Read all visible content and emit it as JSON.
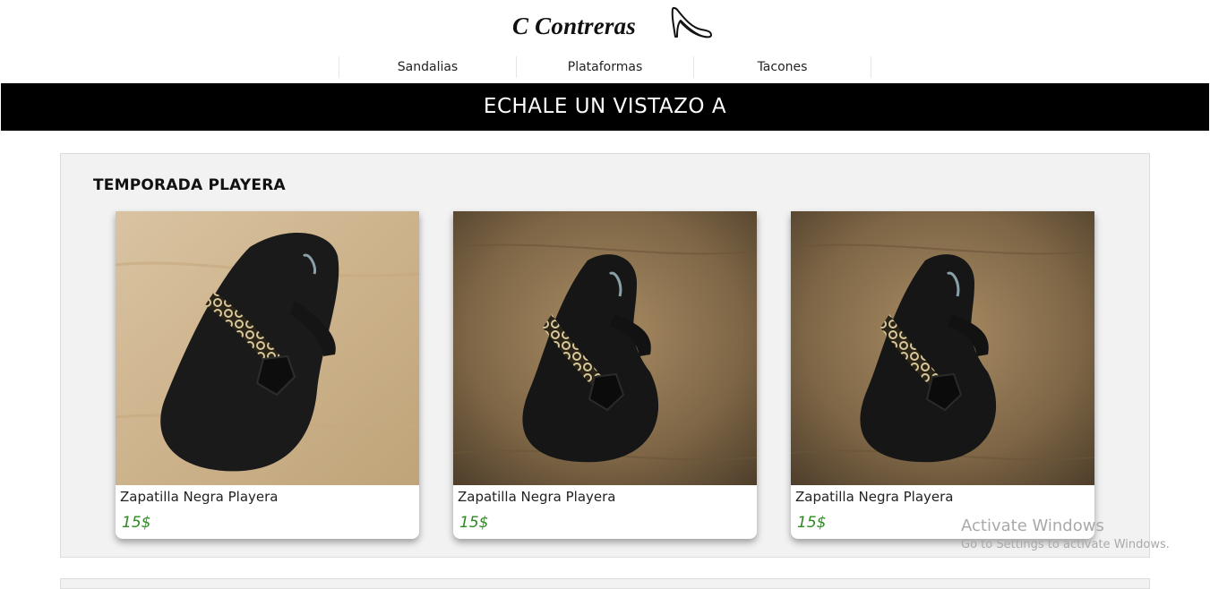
{
  "header": {
    "brand": "C Contreras",
    "logo_icon": "high-heel-shoe-icon"
  },
  "nav": {
    "items": [
      {
        "label": "Sandalias"
      },
      {
        "label": "Plataformas"
      },
      {
        "label": "Tacones"
      }
    ]
  },
  "banner": {
    "text": "ECHALE UN VISTAZO A"
  },
  "section": {
    "title": "TEMPORADA PLAYERA",
    "products": [
      {
        "name": "Zapatilla Negra Playera",
        "price": "15$",
        "image": "black-flip-flop-photo"
      },
      {
        "name": "Zapatilla Negra Playera",
        "price": "15$",
        "image": "black-flip-flop-photo"
      },
      {
        "name": "Zapatilla Negra Playera",
        "price": "15$",
        "image": "black-flip-flop-photo"
      }
    ]
  },
  "watermark": {
    "title": "Activate Windows",
    "subtitle": "Go to Settings to activate Windows."
  },
  "colors": {
    "banner_bg": "#000000",
    "banner_text": "#ffffff",
    "price": "#2e8b22",
    "section_bg": "#f2f2f2"
  }
}
